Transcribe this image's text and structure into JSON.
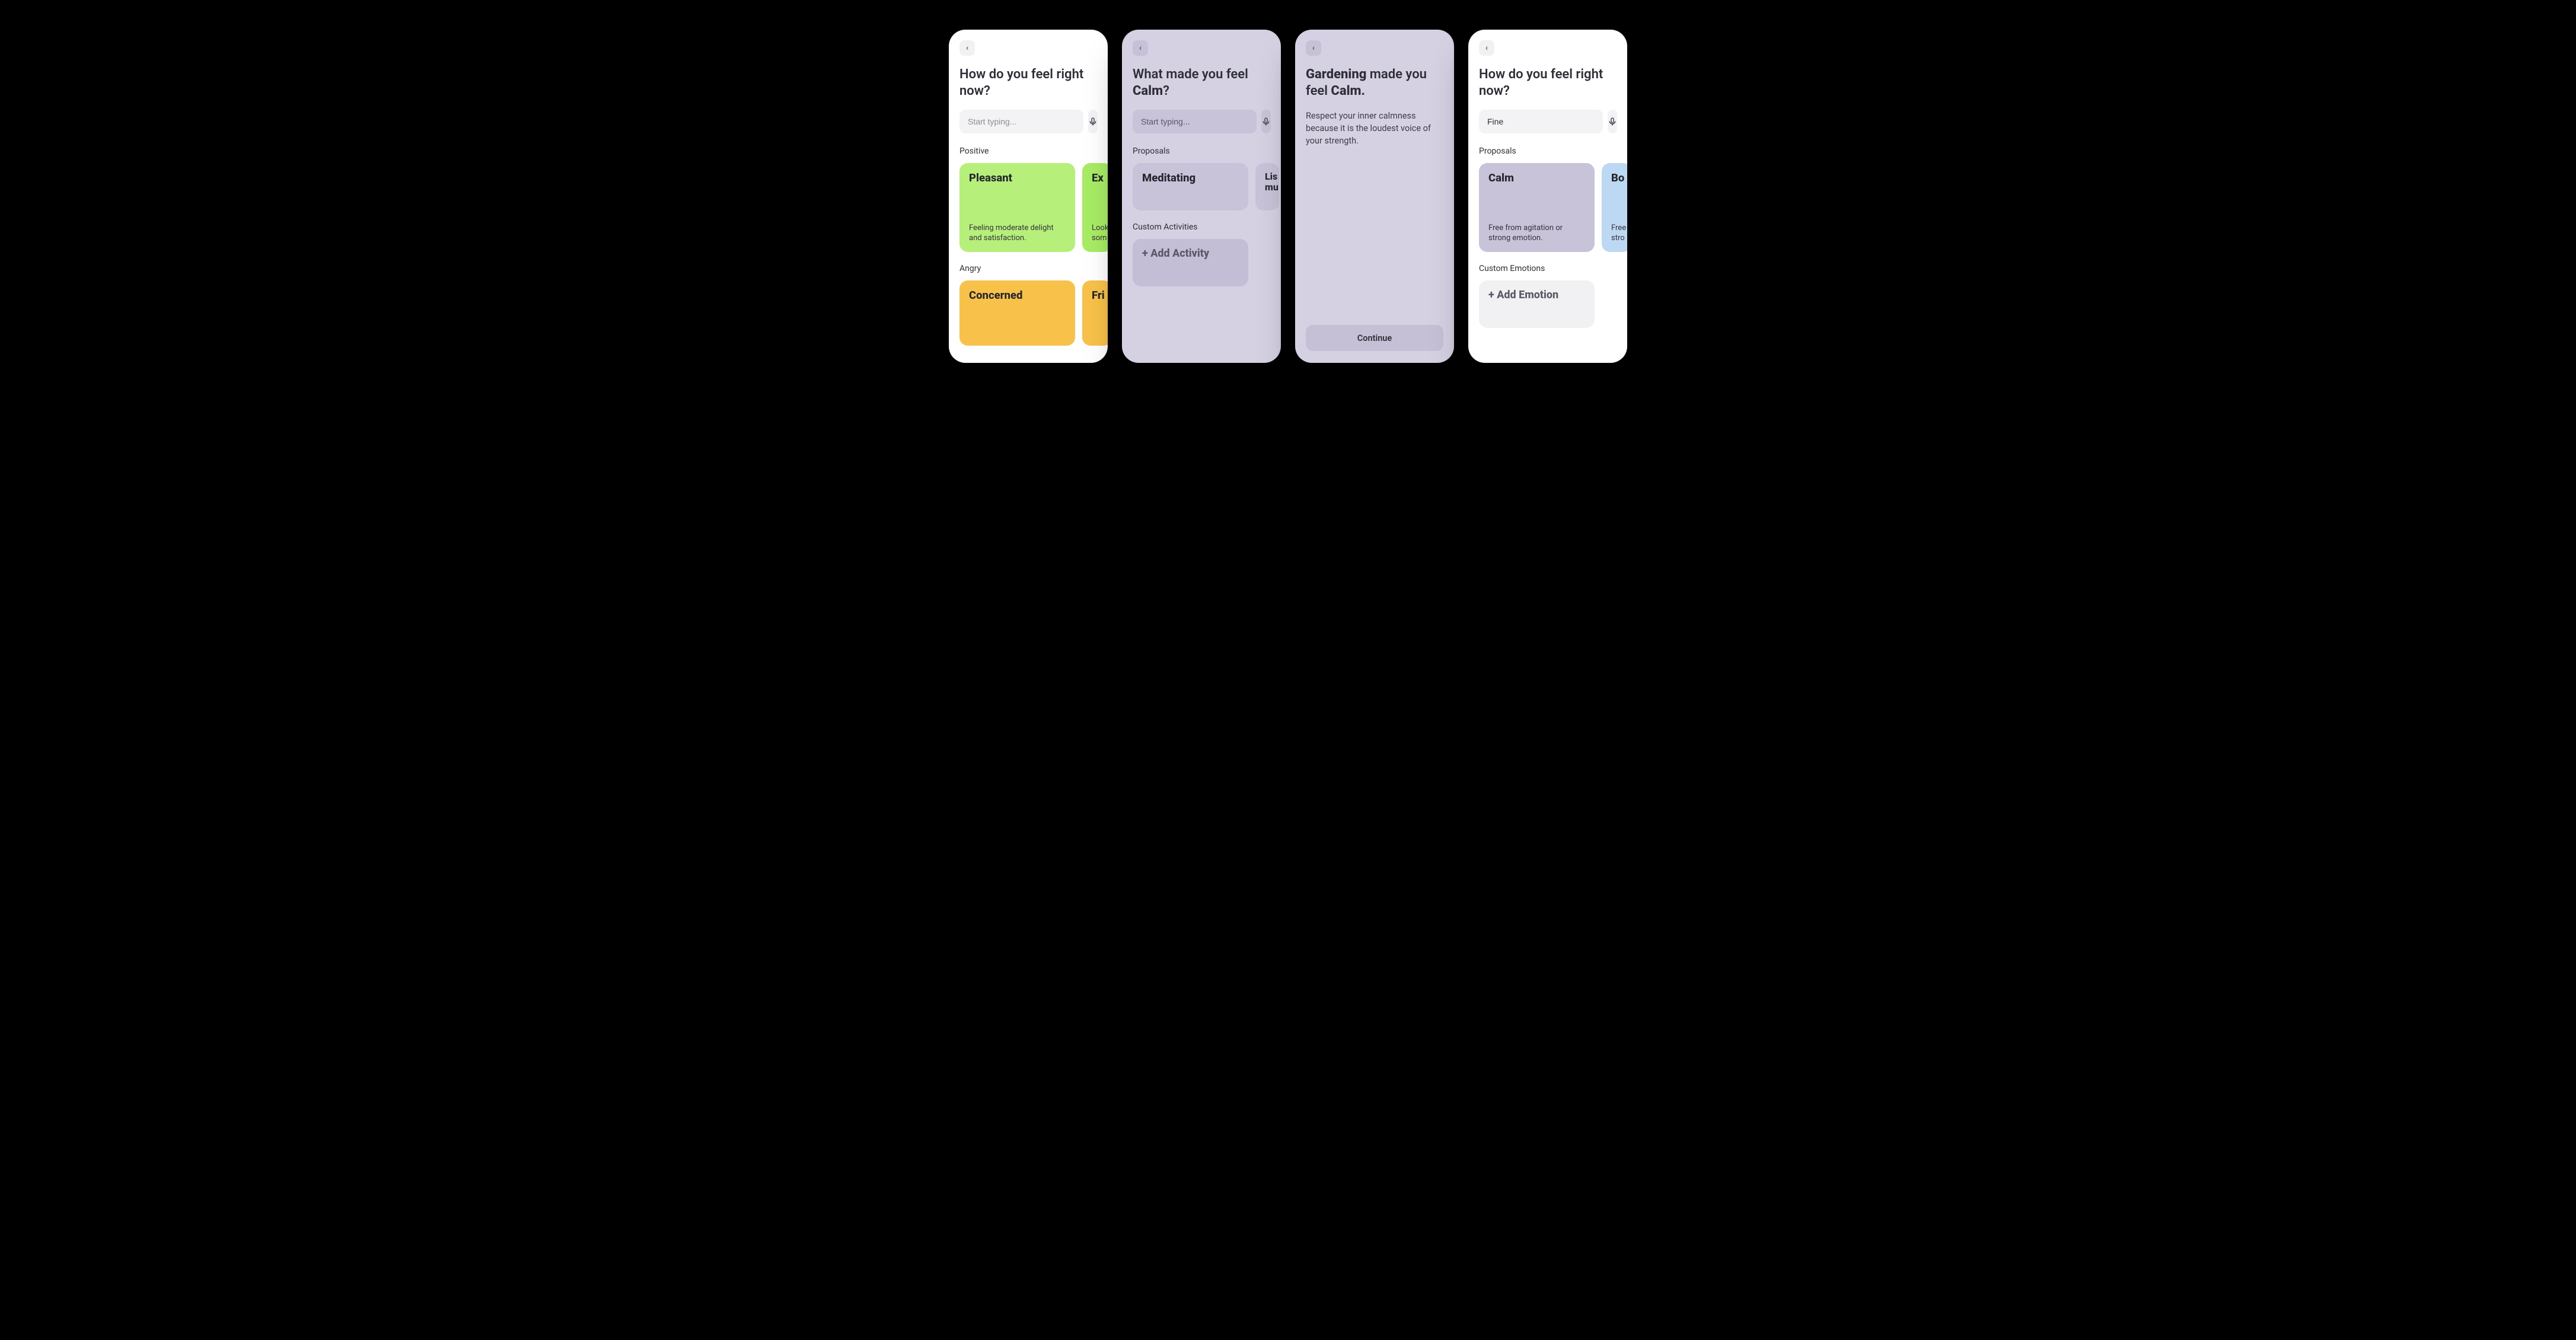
{
  "common": {
    "search_placeholder": "Start typing...",
    "mic_icon": "microphone-icon",
    "back_icon": "chevron-left-icon"
  },
  "screen1": {
    "title": "How do you feel right now?",
    "sections": [
      {
        "label": "Positive",
        "cards": [
          {
            "title": "Pleasant",
            "desc": "Feeling moderate delight and satisfaction.",
            "color": "c-green"
          },
          {
            "title": "Ex",
            "desc": "Look som",
            "color": "c-green2",
            "peek": true
          }
        ]
      },
      {
        "label": "Angry",
        "cards": [
          {
            "title": "Concerned",
            "color": "c-amber"
          },
          {
            "title": "Fri",
            "color": "c-amber",
            "peek": true
          }
        ]
      }
    ]
  },
  "screen2": {
    "title_pre": "What made you feel ",
    "title_bold": "Calm",
    "title_post": "?",
    "sections": [
      {
        "label": "Proposals",
        "cards": [
          {
            "title": "Meditating",
            "color": "c-lilac"
          },
          {
            "title": "Lis mu",
            "color": "c-lilac",
            "peek": true
          }
        ]
      },
      {
        "label": "Custom Activities",
        "cards": [
          {
            "title": "+ Add Activity",
            "color": "c-lilac2",
            "add": true
          }
        ]
      }
    ]
  },
  "screen3": {
    "title_bold1": "Gardening",
    "title_mid": " made you feel ",
    "title_bold2": "Calm.",
    "subtitle": "Respect your inner calmness because it is the loudest voice of your strength.",
    "continue_label": "Continue"
  },
  "screen4": {
    "title": "How do you feel right now?",
    "search_value": "Fine",
    "sections": [
      {
        "label": "Proposals",
        "cards": [
          {
            "title": "Calm",
            "desc": "Free from agitation or strong emotion.",
            "color": "c-lilac"
          },
          {
            "title": "Bo",
            "desc": "Free stro",
            "color": "c-blue",
            "peek": true
          }
        ]
      },
      {
        "label": "Custom Emotions",
        "cards": [
          {
            "title": "+ Add Emotion",
            "color": "c-greyL",
            "add": true
          }
        ]
      }
    ]
  }
}
